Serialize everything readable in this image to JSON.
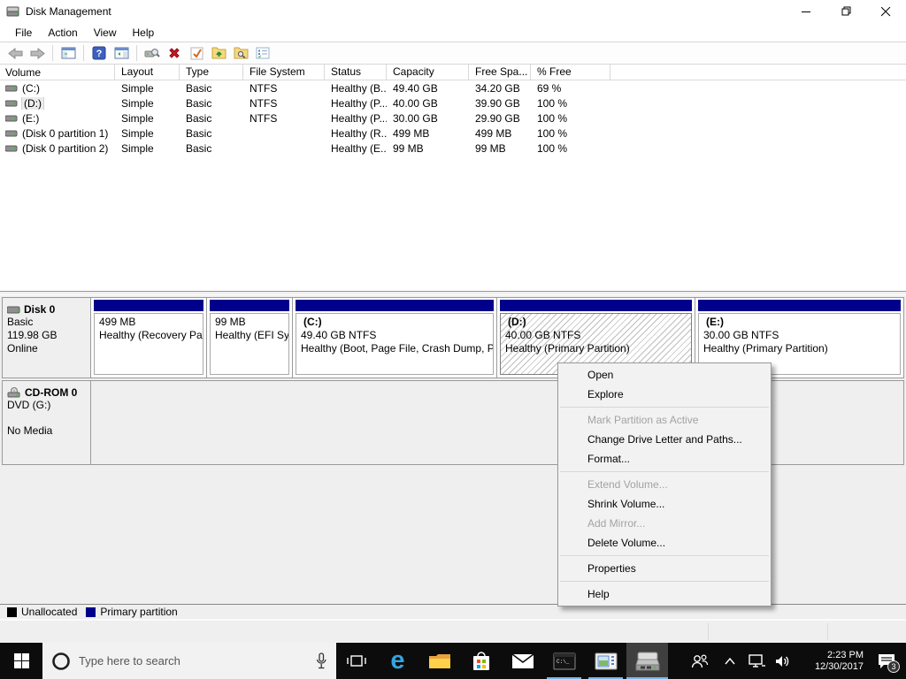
{
  "colors": {
    "primary_partition": "#00008b",
    "unallocated": "#000000",
    "taskbar": "#0c0c0c",
    "running_indicator": "#76b9ed",
    "selection_hatch": "#bdbdbd"
  },
  "window": {
    "title": "Disk Management",
    "icon": "disk-drive-icon",
    "controls": {
      "minimize": "–",
      "restore": "restore-icon",
      "close": "✕"
    }
  },
  "menu": {
    "items": [
      {
        "label": "File"
      },
      {
        "label": "Action"
      },
      {
        "label": "View"
      },
      {
        "label": "Help"
      }
    ]
  },
  "toolbar": {
    "icons": [
      "back-icon",
      "forward-icon",
      "console-tree-icon",
      "help-icon",
      "action-pane-icon",
      "rescan-disks-icon",
      "delete-volume-icon",
      "mark-active-icon",
      "open-icon",
      "explore-icon",
      "properties-icon"
    ]
  },
  "volume_list": {
    "columns": [
      {
        "label": "Volume"
      },
      {
        "label": "Layout"
      },
      {
        "label": "Type"
      },
      {
        "label": "File System"
      },
      {
        "label": "Status"
      },
      {
        "label": "Capacity"
      },
      {
        "label": "Free Spa..."
      },
      {
        "label": "% Free"
      }
    ],
    "rows": [
      {
        "volume": "(C:)",
        "layout": "Simple",
        "type": "Basic",
        "fs": "NTFS",
        "status": "Healthy (B...",
        "capacity": "49.40 GB",
        "free": "34.20 GB",
        "pct": "69 %",
        "selected": false
      },
      {
        "volume": "(D:)",
        "layout": "Simple",
        "type": "Basic",
        "fs": "NTFS",
        "status": "Healthy (P...",
        "capacity": "40.00 GB",
        "free": "39.90 GB",
        "pct": "100 %",
        "selected": true
      },
      {
        "volume": "(E:)",
        "layout": "Simple",
        "type": "Basic",
        "fs": "NTFS",
        "status": "Healthy (P...",
        "capacity": "30.00 GB",
        "free": "29.90 GB",
        "pct": "100 %",
        "selected": false
      },
      {
        "volume": "(Disk 0 partition 1)",
        "layout": "Simple",
        "type": "Basic",
        "fs": "",
        "status": "Healthy (R...",
        "capacity": "499 MB",
        "free": "499 MB",
        "pct": "100 %",
        "selected": false
      },
      {
        "volume": "(Disk 0 partition 2)",
        "layout": "Simple",
        "type": "Basic",
        "fs": "",
        "status": "Healthy (E...",
        "capacity": "99 MB",
        "free": "99 MB",
        "pct": "100 %",
        "selected": false
      }
    ]
  },
  "graph": {
    "disks": [
      {
        "name": "Disk 0",
        "line1": "Basic",
        "line2": "119.98 GB",
        "line3": "Online",
        "partitions": [
          {
            "label": "",
            "size": "499 MB",
            "status": "Healthy (Recovery Par",
            "selected": false
          },
          {
            "label": "",
            "size": "99 MB",
            "status": "Healthy (EFI Sys",
            "selected": false
          },
          {
            "label": "(C:)",
            "size": "49.40 GB NTFS",
            "status": "Healthy (Boot, Page File, Crash Dump, Pr",
            "selected": false
          },
          {
            "label": "(D:)",
            "size": "40.00 GB NTFS",
            "status": "Healthy (Primary Partition)",
            "selected": true
          },
          {
            "label": "(E:)",
            "size": "30.00 GB NTFS",
            "status": "Healthy (Primary Partition)",
            "selected": false
          }
        ]
      },
      {
        "name": "CD-ROM 0",
        "line1": "DVD (G:)",
        "line2": "No Media"
      }
    ]
  },
  "legend": {
    "items": [
      {
        "label": "Unallocated",
        "color": "#000000"
      },
      {
        "label": "Primary partition",
        "color": "#00008b"
      }
    ]
  },
  "context_menu": {
    "items": [
      {
        "label": "Open",
        "enabled": true
      },
      {
        "label": "Explore",
        "enabled": true
      },
      {
        "label": "Mark Partition as Active",
        "enabled": false
      },
      {
        "label": "Change Drive Letter and Paths...",
        "enabled": true
      },
      {
        "label": "Format...",
        "enabled": true
      },
      {
        "label": "Extend Volume...",
        "enabled": false
      },
      {
        "label": "Shrink Volume...",
        "enabled": true
      },
      {
        "label": "Add Mirror...",
        "enabled": false
      },
      {
        "label": "Delete Volume...",
        "enabled": true
      },
      {
        "label": "Properties",
        "enabled": true
      },
      {
        "label": "Help",
        "enabled": true
      }
    ]
  },
  "taskbar": {
    "search_placeholder": "Type here to search",
    "icons": [
      "start-icon",
      "cortana-circle-icon",
      "microphone-icon",
      "task-view-icon",
      "edge-icon",
      "file-explorer-icon",
      "store-icon",
      "mail-icon",
      "cmd-icon",
      "management-console-icon",
      "disk-management-icon",
      "people-icon",
      "chevron-up-icon",
      "network-icon",
      "speaker-icon",
      "action-center-icon"
    ],
    "clock": {
      "time": "2:23 PM",
      "date": "12/30/2017"
    },
    "action_center_badge": "3"
  }
}
